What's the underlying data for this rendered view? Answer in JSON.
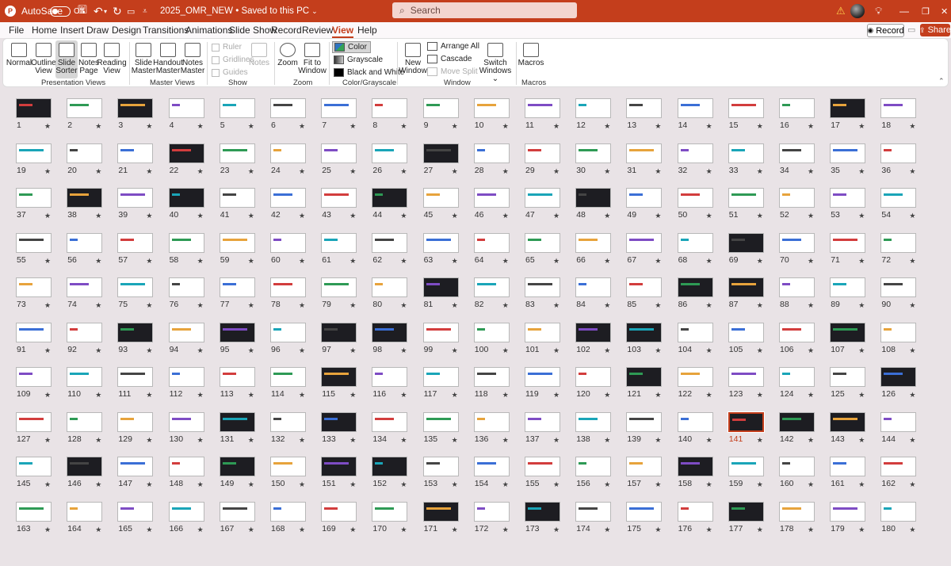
{
  "titlebar": {
    "autosave": "AutoSave",
    "toggle_state": "Off",
    "doc_title": "2025_OMR_NEW • Saved to this PC",
    "search_placeholder": "Search"
  },
  "menu": {
    "tabs": [
      "File",
      "Home",
      "Insert",
      "Draw",
      "Design",
      "Transitions",
      "Animations",
      "Slide Show",
      "Record",
      "Review",
      "View",
      "Help"
    ],
    "active": "View",
    "record_label": "Record",
    "share_label": "Share"
  },
  "ribbon": {
    "presentation_views": {
      "normal": "Normal",
      "outline_1": "Outline",
      "outline_2": "View",
      "sorter_1": "Slide",
      "sorter_2": "Sorter",
      "notes_1": "Notes",
      "notes_2": "Page",
      "reading_1": "Reading",
      "reading_2": "View",
      "group": "Presentation Views"
    },
    "master_views": {
      "slide_1": "Slide",
      "slide_2": "Master",
      "handout_1": "Handout",
      "handout_2": "Master",
      "notes_1": "Notes",
      "notes_2": "Master",
      "group": "Master Views"
    },
    "show": {
      "ruler": "Ruler",
      "gridlines": "Gridlines",
      "guides": "Guides",
      "notes": "Notes",
      "group": "Show"
    },
    "zoom": {
      "zoom": "Zoom",
      "fit_1": "Fit to",
      "fit_2": "Window",
      "group": "Zoom"
    },
    "color": {
      "color": "Color",
      "grayscale": "Grayscale",
      "bw": "Black and White",
      "group": "Color/Grayscale"
    },
    "window": {
      "new_1": "New",
      "new_2": "Window",
      "arrange": "Arrange All",
      "cascade": "Cascade",
      "move_split": "Move Split",
      "switch_1": "Switch",
      "switch_2": "Windows",
      "group": "Window"
    },
    "macros": {
      "macros": "Macros",
      "group": "Macros"
    }
  },
  "slides": {
    "total_visible": 180,
    "selected": 141,
    "star": "★"
  }
}
